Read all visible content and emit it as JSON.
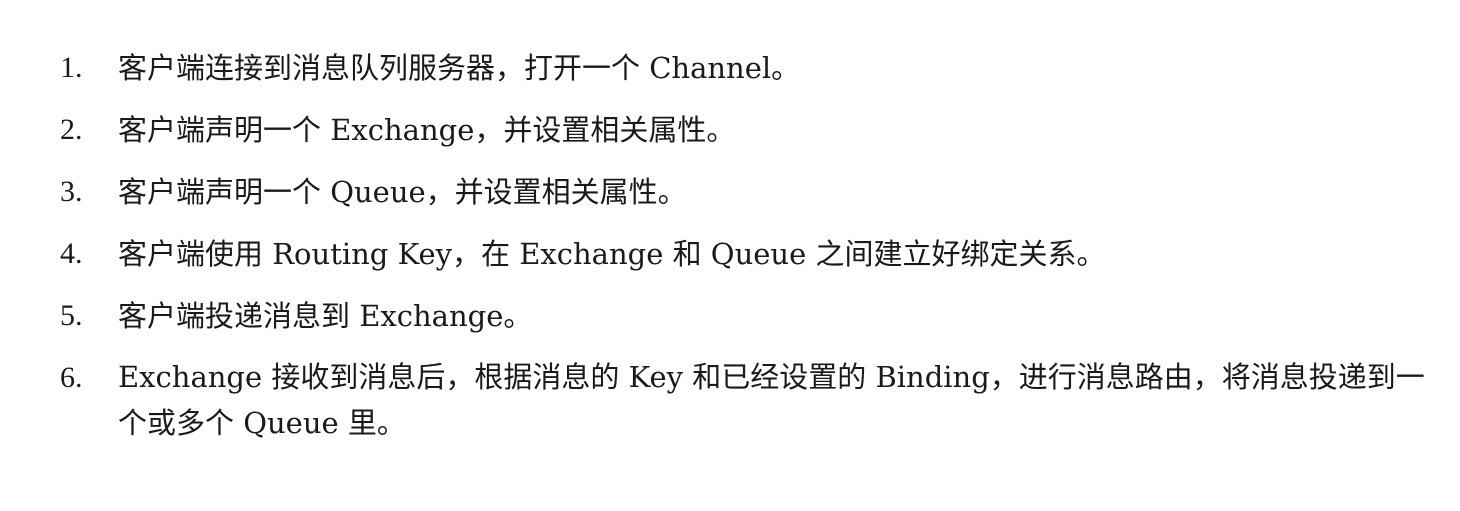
{
  "steps": [
    {
      "number": "1.",
      "text": "客户端连接到消息队列服务器，打开一个 Channel。"
    },
    {
      "number": "2.",
      "text": "客户端声明一个 Exchange，并设置相关属性。"
    },
    {
      "number": "3.",
      "text": "客户端声明一个 Queue，并设置相关属性。"
    },
    {
      "number": "4.",
      "text": "客户端使用 Routing Key，在 Exchange 和 Queue 之间建立好绑定关系。"
    },
    {
      "number": "5.",
      "text": "客户端投递消息到 Exchange。"
    },
    {
      "number": "6.",
      "text": "Exchange 接收到消息后，根据消息的 Key 和已经设置的 Binding，进行消息路由，将消息投递到一个或多个 Queue 里。"
    }
  ]
}
